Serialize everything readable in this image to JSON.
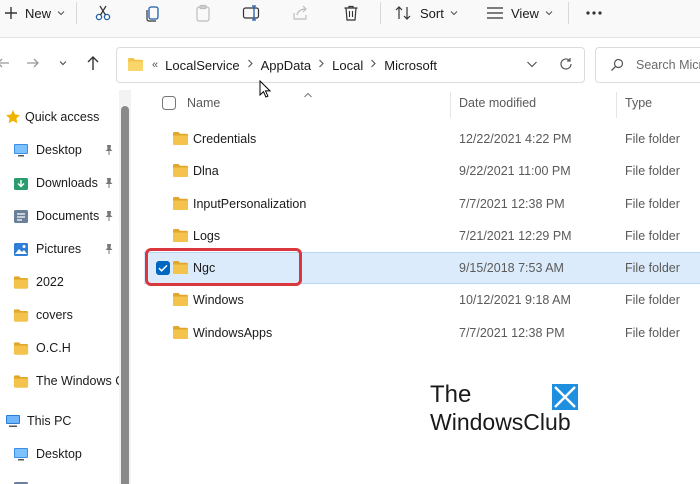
{
  "toolbar": {
    "new_label": "New",
    "sort_label": "Sort",
    "view_label": "View",
    "icons": [
      "add-icon",
      "cut-icon",
      "copy-icon",
      "paste-icon",
      "rename-icon",
      "share-icon",
      "delete-icon",
      "sort-icon",
      "view-icon",
      "more-icon"
    ]
  },
  "address": {
    "overflow": "«",
    "crumbs": [
      "LocalService",
      "AppData",
      "Local",
      "Microsoft"
    ]
  },
  "search": {
    "placeholder": "Search Micr"
  },
  "sidebar": {
    "items": [
      {
        "label": "Quick access",
        "icon": "star-icon",
        "pinned": false
      },
      {
        "label": "Desktop",
        "icon": "desktop-icon",
        "pinned": true
      },
      {
        "label": "Downloads",
        "icon": "downloads-icon",
        "pinned": true
      },
      {
        "label": "Documents",
        "icon": "documents-icon",
        "pinned": true
      },
      {
        "label": "Pictures",
        "icon": "pictures-icon",
        "pinned": true
      },
      {
        "label": "2022",
        "icon": "folder-icon",
        "pinned": false
      },
      {
        "label": "covers",
        "icon": "folder-icon",
        "pinned": false
      },
      {
        "label": "O.C.H",
        "icon": "folder-icon",
        "pinned": false
      },
      {
        "label": "The Windows C",
        "icon": "folder-icon",
        "pinned": false
      },
      {
        "label": "This PC",
        "icon": "pc-icon",
        "pinned": false
      },
      {
        "label": "Desktop",
        "icon": "desktop-icon",
        "pinned": false
      }
    ]
  },
  "columns": {
    "name": "Name",
    "date": "Date modified",
    "type": "Type"
  },
  "files": [
    {
      "name": "Credentials",
      "date": "12/22/2021 4:22 PM",
      "type": "File folder",
      "selected": false
    },
    {
      "name": "Dlna",
      "date": "9/22/2021 11:00 PM",
      "type": "File folder",
      "selected": false
    },
    {
      "name": "InputPersonalization",
      "date": "7/7/2021 12:38 PM",
      "type": "File folder",
      "selected": false
    },
    {
      "name": "Logs",
      "date": "7/21/2021 12:29 PM",
      "type": "File folder",
      "selected": false
    },
    {
      "name": "Ngc",
      "date": "9/15/2018 7:53 AM",
      "type": "File folder",
      "selected": true
    },
    {
      "name": "Windows",
      "date": "10/12/2021 9:18 AM",
      "type": "File folder",
      "selected": false
    },
    {
      "name": "WindowsApps",
      "date": "7/7/2021 12:38 PM",
      "type": "File folder",
      "selected": false
    }
  ],
  "watermark": {
    "line1": "The",
    "line2": "WindowsClub"
  },
  "colors": {
    "folder": "#f3c34c",
    "folder_dark": "#e1a72a",
    "selection": "#dcebfb",
    "highlight": "#d9363e",
    "accent": "#0067c0"
  }
}
